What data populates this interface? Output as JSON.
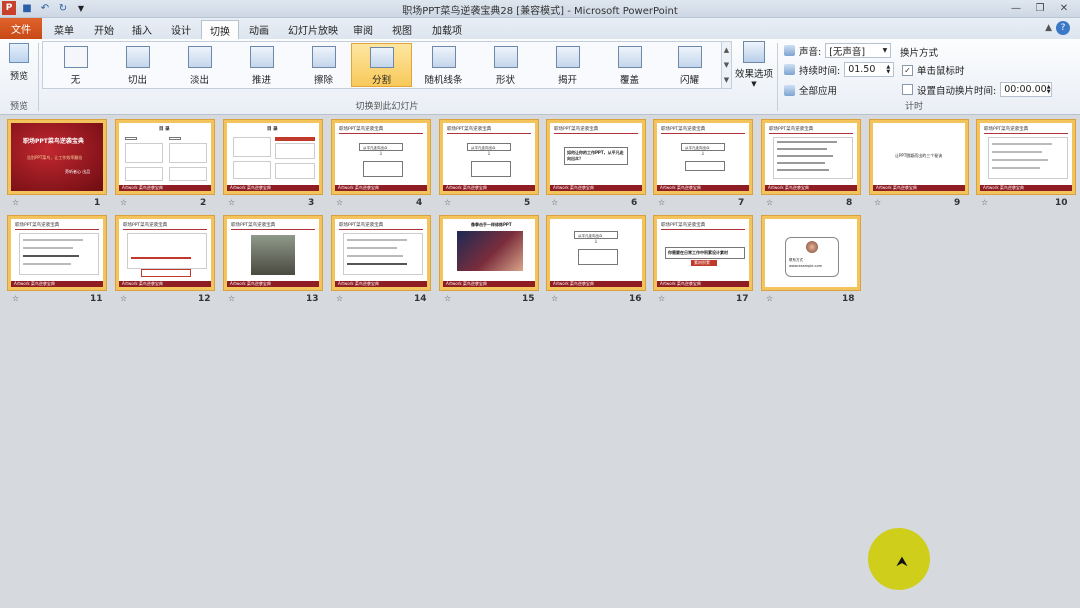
{
  "titlebar": {
    "title": "职场PPT菜鸟逆袭宝典28 [兼容模式] - Microsoft PowerPoint",
    "qat_icons": [
      "ppt-logo-icon",
      "save-icon",
      "undo-icon",
      "redo-icon",
      "customize-icon"
    ]
  },
  "tabs": {
    "file": "文件",
    "items": [
      "菜单",
      "开始",
      "插入",
      "设计",
      "切换",
      "动画",
      "幻灯片放映",
      "审阅",
      "视图",
      "加载项"
    ],
    "active": "切换"
  },
  "ribbon": {
    "preview": {
      "label": "预览",
      "group": "预览"
    },
    "transitions": {
      "group": "切换到此幻灯片",
      "items": [
        "无",
        "切出",
        "淡出",
        "推进",
        "擦除",
        "分割",
        "随机线条",
        "形状",
        "揭开",
        "覆盖",
        "闪耀"
      ],
      "selected": "分割"
    },
    "effect_options": {
      "label": "效果选项"
    },
    "timing": {
      "group": "计时",
      "sound_label": "声音:",
      "sound_value": "[无声音]",
      "duration_label": "持续时间:",
      "duration_value": "01.50",
      "apply_all": "全部应用",
      "advance_title": "换片方式",
      "on_click_label": "单击鼠标时",
      "on_click_checked": true,
      "auto_label": "设置自动换片时间:",
      "auto_checked": false,
      "auto_value": "00:00.00"
    }
  },
  "slides": {
    "header_text": "职场PPT菜鸟逆袭宝典",
    "footer_text": "Artwork 菜鸟逆袭宝典",
    "s1_title": "职场PPT菜鸟逆袭宝典",
    "s1_sub": "告别PPT菜鸟，让工作效率翻倍",
    "s1_author": "旁听者心 出品",
    "s2_title": "目 录",
    "s3_title": "目 录",
    "flow_label": "从平凡走向出众",
    "s6_text": "如何让你的工作PPT，从平凡走向出众？",
    "s9_text": "让PPT脱颖而出的三个秘诀",
    "s15_title": "像拳击手一样修炼PPT",
    "s17_text": "你需要在日常工作中积累设计素材",
    "s17_tag": "素材积累",
    "s18_contact": "联系方式 · www.example.com",
    "numbers": [
      "1",
      "2",
      "3",
      "4",
      "5",
      "6",
      "7",
      "8",
      "9",
      "10",
      "11",
      "12",
      "13",
      "14",
      "15",
      "16",
      "17",
      "18"
    ]
  }
}
